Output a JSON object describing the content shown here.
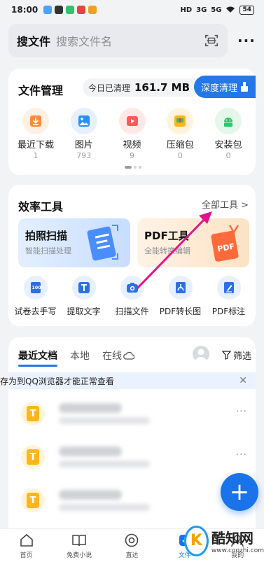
{
  "status_bar": {
    "time": "18:00",
    "network_1": "HD",
    "signal_1": "3G",
    "signal_2": "5G",
    "battery": "54"
  },
  "search": {
    "title": "搜文件",
    "placeholder": "搜索文件名"
  },
  "file_manager": {
    "title": "文件管理",
    "cleaned_label": "今日已清理",
    "cleaned_value": "161.7 MB",
    "deep_clean": "深度清理",
    "items": [
      {
        "label": "最近下载",
        "count": "1",
        "icon": "download-icon",
        "color": "#ff8a3d"
      },
      {
        "label": "图片",
        "count": "793",
        "icon": "image-icon",
        "color": "#2d8cff"
      },
      {
        "label": "视频",
        "count": "9",
        "icon": "video-icon",
        "color": "#ff5a5a"
      },
      {
        "label": "压缩包",
        "count": "0",
        "icon": "archive-icon",
        "color": "#ffb619"
      },
      {
        "label": "安装包",
        "count": "0",
        "icon": "android-icon",
        "color": "#2fc36b"
      }
    ]
  },
  "tools": {
    "title": "效率工具",
    "all_tools": "全部工具 >",
    "promo_scan": {
      "title": "拍照扫描",
      "sub": "智能扫描处理"
    },
    "promo_pdf": {
      "title": "PDF工具",
      "sub": "全能转换编辑"
    },
    "items": [
      {
        "label": "试卷去手写",
        "icon": "exam-icon"
      },
      {
        "label": "提取文字",
        "icon": "text-extract-icon"
      },
      {
        "label": "扫描文件",
        "icon": "camera-scan-icon"
      },
      {
        "label": "PDF转长图",
        "icon": "pdf-icon"
      },
      {
        "label": "PDF标注",
        "icon": "pdf-edit-icon"
      }
    ]
  },
  "docs": {
    "tabs": [
      "最近文档",
      "本地",
      "在线"
    ],
    "filter": "筛选",
    "notice": "存为到QQ浏览器才能正常查看",
    "doc_icon_letter": "T",
    "more": "···"
  },
  "fab": "+",
  "bottom_nav": [
    {
      "label": "首页",
      "icon": "home-icon"
    },
    {
      "label": "免费小说",
      "icon": "book-icon"
    },
    {
      "label": "直达",
      "icon": "at-icon"
    },
    {
      "label": "文件",
      "icon": "file-icon"
    },
    {
      "label": "我的",
      "icon": "user-icon"
    }
  ],
  "watermark": {
    "logo": "K",
    "name": "酷知网",
    "url": "www.coozhi.com"
  }
}
